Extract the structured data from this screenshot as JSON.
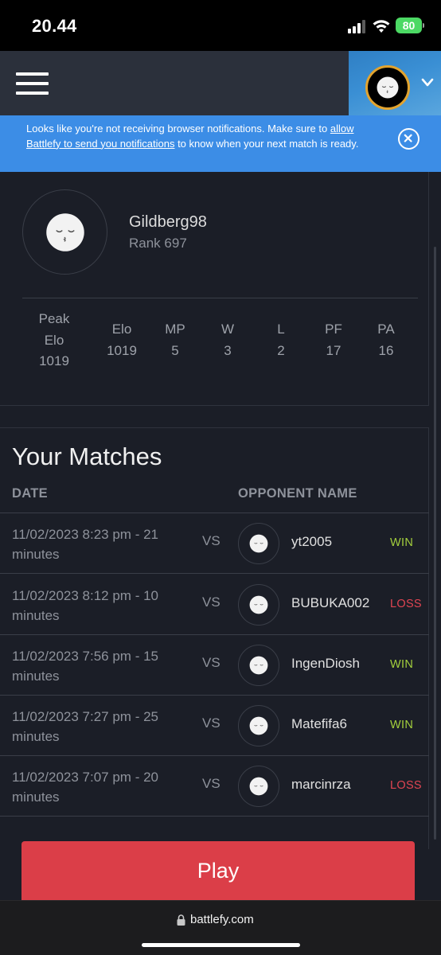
{
  "status_bar": {
    "time": "20.44",
    "battery": "80"
  },
  "banner": {
    "text_before": "Looks like you're not receiving browser notifications. Make sure to ",
    "link_text": "allow Battlefy to send you notifications",
    "text_after": " to know when your next match is ready."
  },
  "profile": {
    "username": "Gildberg98",
    "rank": "Rank 697",
    "stats": [
      {
        "label_1": "Peak",
        "label_2": "Elo",
        "value": "1019"
      },
      {
        "label_1": "Elo",
        "value": "1019"
      },
      {
        "label_1": "MP",
        "value": "5"
      },
      {
        "label_1": "W",
        "value": "3"
      },
      {
        "label_1": "L",
        "value": "2"
      },
      {
        "label_1": "PF",
        "value": "17"
      },
      {
        "label_1": "PA",
        "value": "16"
      }
    ]
  },
  "matches": {
    "title": "Your Matches",
    "headers": {
      "date": "DATE",
      "opponent": "OPPONENT NAME"
    },
    "vs_label": "VS",
    "rows": [
      {
        "date": "11/02/2023 8:23 pm - 21 minutes",
        "opponent": "yt2005",
        "result": "WIN"
      },
      {
        "date": "11/02/2023 8:12 pm - 10 minutes",
        "opponent": "BUBUKA002",
        "result": "LOSS"
      },
      {
        "date": "11/02/2023 7:56 pm - 15 minutes",
        "opponent": "IngenDiosh",
        "result": "WIN"
      },
      {
        "date": "11/02/2023 7:27 pm - 25 minutes",
        "opponent": "Matefifa6",
        "result": "WIN"
      },
      {
        "date": "11/02/2023 7:07 pm - 20 minutes",
        "opponent": "marcinrza",
        "result": "LOSS"
      }
    ]
  },
  "play_button": "Play",
  "browser": {
    "url": "battlefy.com"
  },
  "colors": {
    "background": "#1b1e27",
    "header": "#2b303b",
    "banner": "#3c8de6",
    "win": "#a3cf3d",
    "loss": "#e04552",
    "play": "#db3e48"
  },
  "icons": [
    "signal-icon",
    "wifi-icon",
    "battery-icon",
    "menu-icon",
    "chevron-down-icon",
    "close-icon",
    "lock-icon",
    "avatar-face-icon"
  ]
}
